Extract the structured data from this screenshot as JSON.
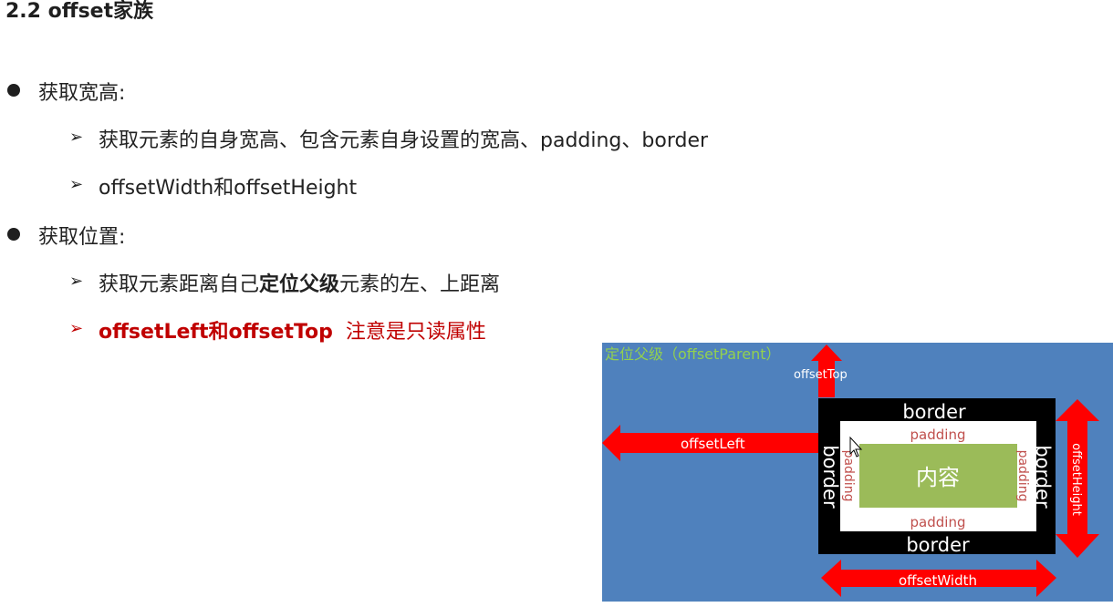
{
  "heading": "2.2 offset家族",
  "sections": [
    {
      "label": "获取宽高:",
      "subitems": [
        {
          "text": "获取元素的自身宽高、包含元素自身设置的宽高、padding、border"
        },
        {
          "text": "offsetWidth和offsetHeight"
        }
      ]
    },
    {
      "label": "获取位置:",
      "subitems": [
        {
          "pre": "获取元素距离自己",
          "bold": "定位父级",
          "post": "元素的左、上距离"
        },
        {
          "bold": "offsetLeft和offsetTop",
          "post": "注意是只读属性"
        }
      ]
    }
  ],
  "diagram": {
    "parent_label": "定位父级（offsetParent）",
    "offset_top": "offsetTop",
    "offset_left": "offsetLeft",
    "offset_height": "offsetHeight",
    "offset_width": "offsetWidth",
    "border": "border",
    "padding": "padding",
    "content": "内容",
    "colors": {
      "parent_bg": "#4f81bd",
      "parent_label": "#92d050",
      "border": "#000000",
      "padding_bg": "#ffffff",
      "padding_text": "#c0504d",
      "content_bg": "#9bbb59",
      "arrow": "#ff0000"
    }
  }
}
